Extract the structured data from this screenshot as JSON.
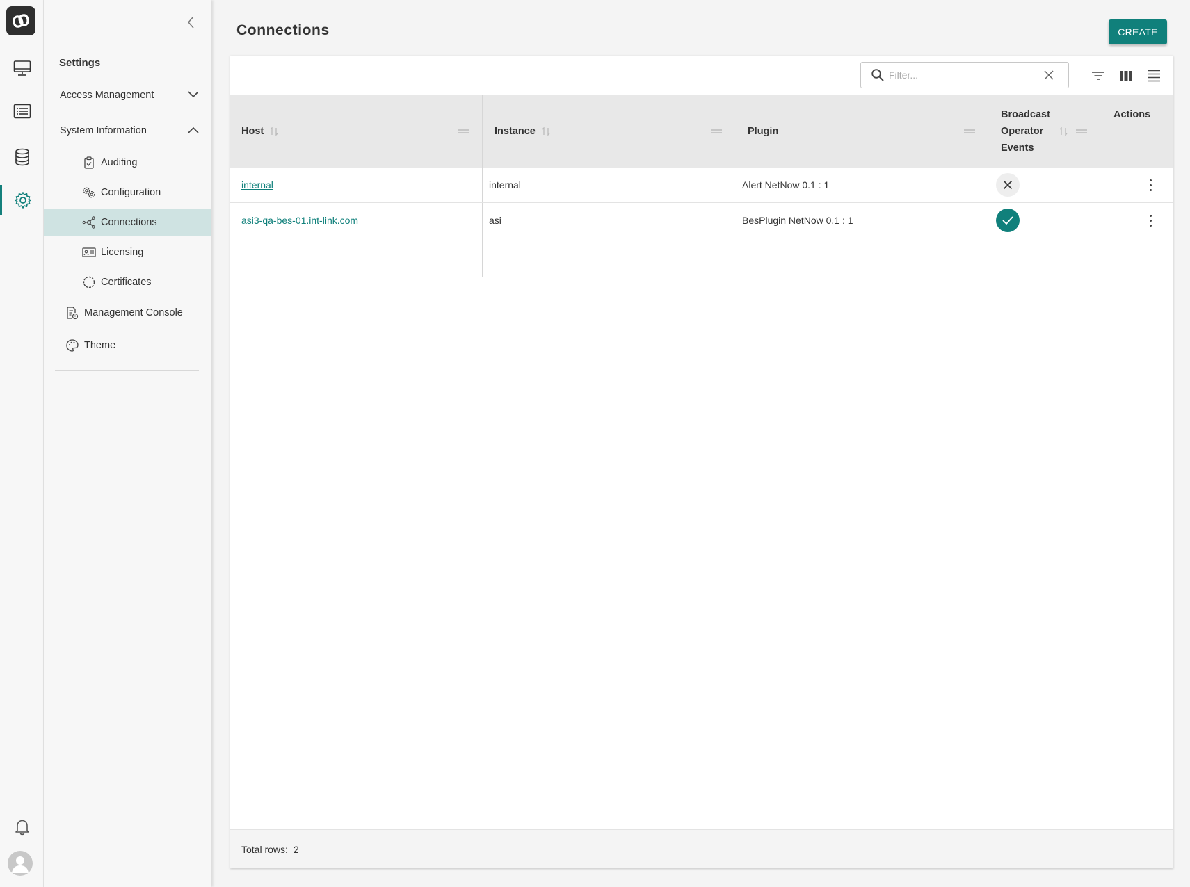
{
  "app": {
    "logo": "app-logo-icon"
  },
  "rail": {
    "items": [
      {
        "name": "monitor-icon"
      },
      {
        "name": "list-icon"
      },
      {
        "name": "database-icon"
      },
      {
        "name": "gear-icon",
        "active": true
      }
    ],
    "bottom": [
      "bell-icon",
      "user-avatar-icon"
    ]
  },
  "sidebar": {
    "title": "Settings",
    "items": [
      {
        "label": "Access Management",
        "icon": "chevron-down-icon"
      },
      {
        "label": "System Information",
        "icon": "chevron-up-icon"
      },
      {
        "label": "Auditing",
        "icon": "clipboard-check-icon"
      },
      {
        "label": "Configuration",
        "icon": "gears-icon"
      },
      {
        "label": "Connections",
        "icon": "network-icon",
        "selected": true
      },
      {
        "label": "Licensing",
        "icon": "id-card-icon"
      },
      {
        "label": "Certificates",
        "icon": "certificate-icon"
      },
      {
        "label": "Management Console",
        "icon": "console-doc-icon"
      },
      {
        "label": "Theme",
        "icon": "palette-icon"
      }
    ]
  },
  "page": {
    "title": "Connections",
    "create_label": "CREATE"
  },
  "filter": {
    "placeholder": "Filter..."
  },
  "table": {
    "columns": {
      "host": "Host",
      "instance": "Instance",
      "plugin": "Plugin",
      "broadcast_1": "Broadcast",
      "broadcast_2": "Operator",
      "broadcast_3": "Events",
      "actions": "Actions"
    },
    "rows": [
      {
        "host": "internal",
        "instance": "internal",
        "plugin": "Alert NetNow 0.1 : 1",
        "broadcast": false
      },
      {
        "host": "asi3-qa-bes-01.int-link.com",
        "instance": "asi",
        "plugin": "BesPlugin NetNow 0.1 : 1",
        "broadcast": true
      }
    ]
  },
  "footer": {
    "total_label": "Total rows:",
    "total_value": "2"
  },
  "colors": {
    "accent": "#10807b",
    "selected_nav": "#cfe3e2",
    "header_bg": "#e8e8e8"
  }
}
